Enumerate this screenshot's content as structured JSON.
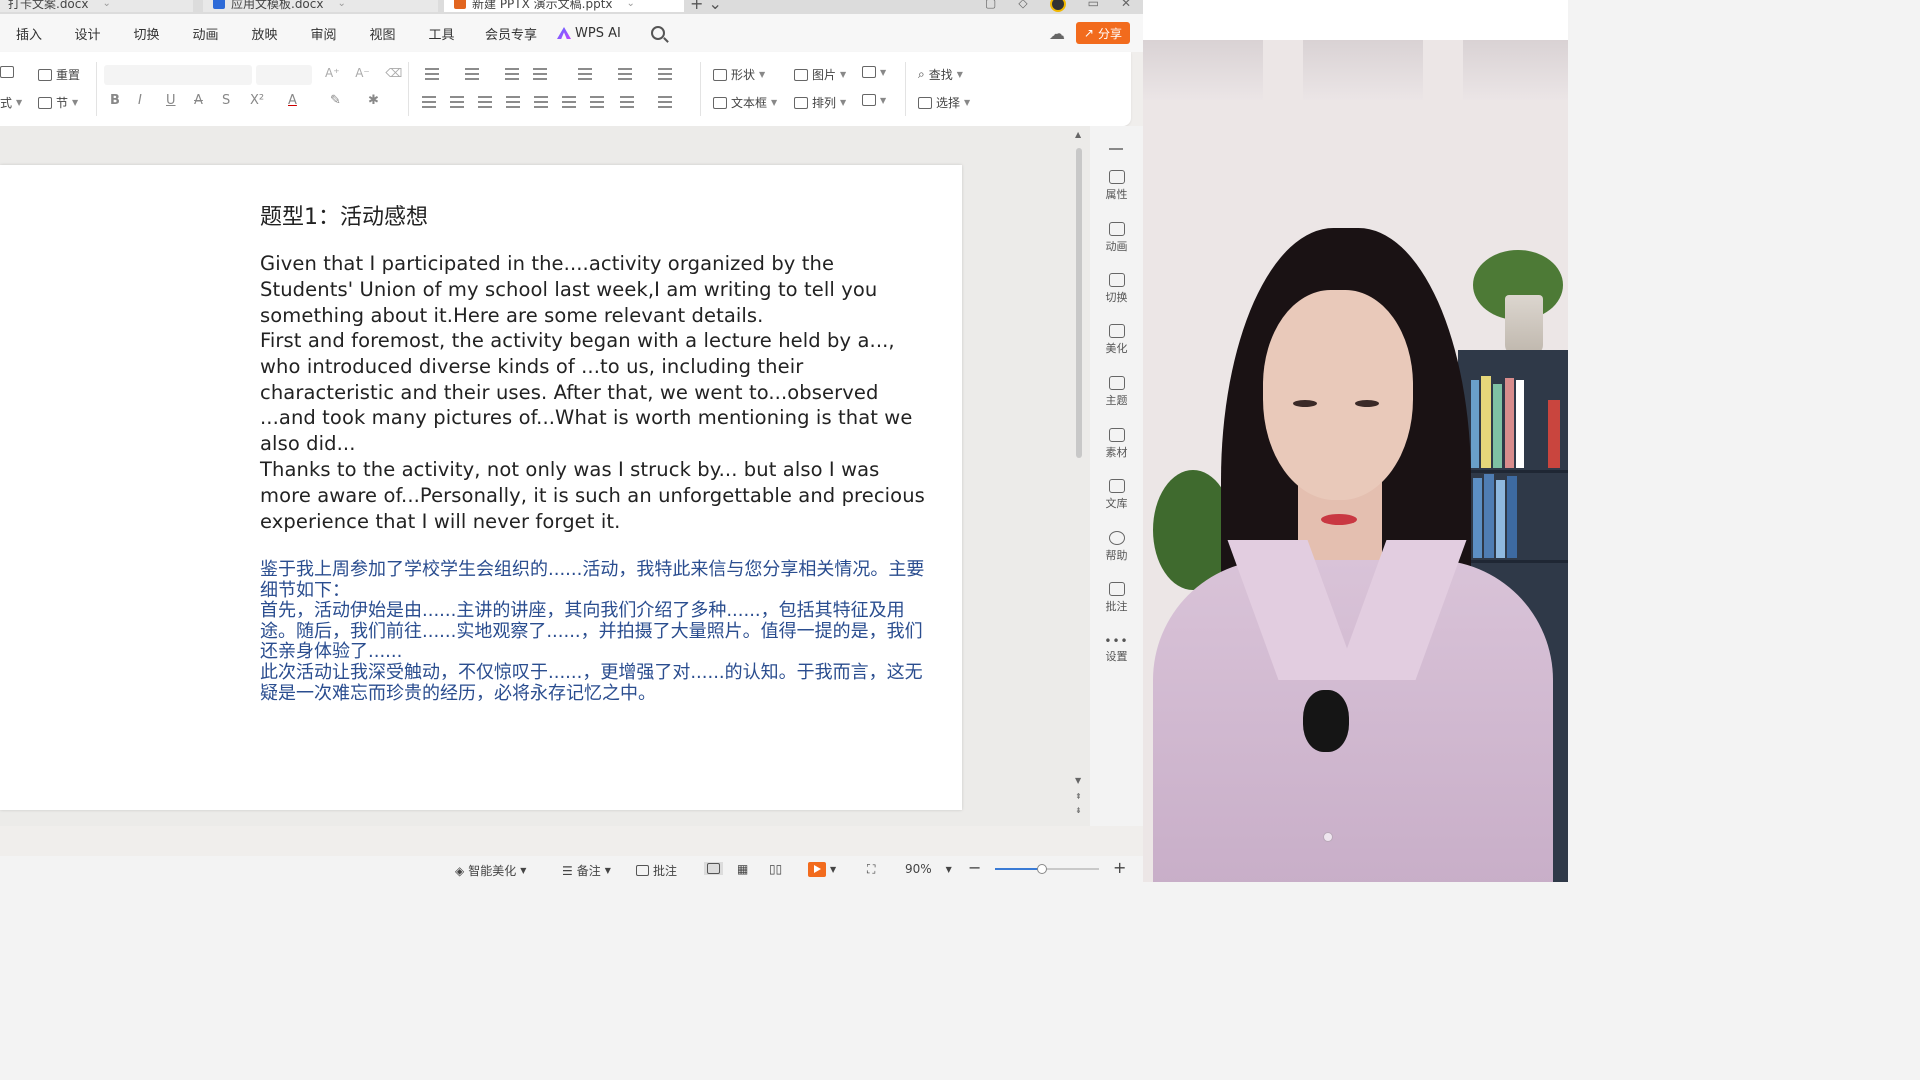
{
  "tabs": [
    {
      "label": "打卡文案.docx",
      "icon_color": "#d9532a"
    },
    {
      "label": "应用文模板.docx",
      "icon_color": "#2e6bd8"
    },
    {
      "label": "新建 PPTX 演示文稿.pptx",
      "icon_color": "#e2651f"
    }
  ],
  "menu": {
    "items": [
      "插入",
      "设计",
      "切换",
      "动画",
      "放映",
      "审阅",
      "视图",
      "工具",
      "会员专享"
    ],
    "wps_ai": "WPS AI",
    "share": "分享"
  },
  "ribbon": {
    "reset": "重置",
    "layout_prefix": "式",
    "section": "节",
    "shape": "形状",
    "picture": "图片",
    "find": "查找",
    "textbox": "文本框",
    "arrange": "排列",
    "select": "选择",
    "format_buttons": [
      "B",
      "I",
      "U",
      "A",
      "S",
      "X²",
      "A"
    ]
  },
  "slide": {
    "title": "题型1：活动感想",
    "english": [
      "Given that I participated in the....activity organized by the Students' Union of my school last week,I am writing to tell you something about it.Here are some relevant details.",
      "First and foremost, the activity began with a lecture held by a..., who introduced diverse kinds of ...to us, including their characteristic and their uses. After that, we went to...observed ...and took many pictures of...What is worth mentioning is that we also did...",
      "Thanks to the activity, not only was I struck by... but also I was more aware of...Personally, it is such an unforgettable and precious experience that I will never forget it."
    ],
    "chinese": [
      "鉴于我上周参加了学校学生会组织的......活动，我特此来信与您分享相关情况。主要细节如下：",
      "首先，活动伊始是由......主讲的讲座，其向我们介绍了多种......，包括其特征及用途。随后，我们前往......实地观察了......，并拍摄了大量照片。值得一提的是，我们还亲身体验了......",
      "此次活动让我深受触动，不仅惊叹于......，更增强了对......的认知。于我而言，这无疑是一次难忘而珍贵的经历，必将永存记忆之中。"
    ]
  },
  "side_panel": [
    "属性",
    "动画",
    "切换",
    "美化",
    "主题",
    "素材",
    "文库",
    "帮助",
    "批注",
    "设置"
  ],
  "status": {
    "smart_beautify": "智能美化",
    "notes": "备注",
    "comments": "批注",
    "zoom": "90%",
    "zoom_fraction": 0.45
  },
  "colors": {
    "accent": "#f26b1d",
    "chinese_text": "#2a4d8f"
  }
}
